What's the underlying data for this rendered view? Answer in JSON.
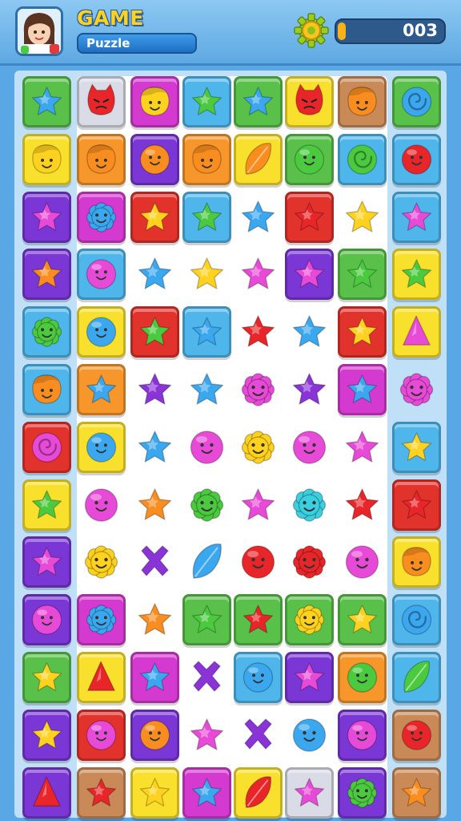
{
  "header": {
    "title": "GAME",
    "subtitle": "Puzzle",
    "score": "003",
    "score_progress": 0.08,
    "settings_icon": "gear-coin-icon",
    "avatar_icon": "player-avatar-icon"
  },
  "colors": {
    "background": "#5aa7e6",
    "title": "#ffd21f",
    "score_fill": "#f7b21a"
  },
  "tile_colors": {
    "b": "#4fb6ec",
    "y": "#f9e02c",
    "p": "#7b36d6",
    "r": "#e2322c",
    "g": "#59c04a",
    "m": "#d53ad0",
    "o": "#f7962a",
    "br": "#c98a58",
    "gr": "#d9dbe6",
    "w": "none"
  },
  "piece_colors": {
    "b": "#3aa7ef",
    "y": "#ffd21f",
    "p": "#8a34d8",
    "r": "#e8262a",
    "g": "#4bc93f",
    "m": "#e84ad8",
    "o": "#f98d1f",
    "t": "#3ad0e0"
  },
  "board": {
    "rows": [
      [
        {
          "t": "g",
          "s": "star",
          "c": "b"
        },
        {
          "t": "gr",
          "s": "devil",
          "c": "r"
        },
        {
          "t": "m",
          "s": "face",
          "c": "y"
        },
        {
          "t": "b",
          "s": "star",
          "c": "g"
        },
        {
          "t": "g",
          "s": "star",
          "c": "b"
        },
        {
          "t": "y",
          "s": "devil",
          "c": "r"
        },
        {
          "t": "br",
          "s": "face",
          "c": "o"
        },
        {
          "t": "g",
          "s": "swirl",
          "c": "b"
        }
      ],
      [
        {
          "t": "y",
          "s": "face",
          "c": "y"
        },
        {
          "t": "o",
          "s": "face",
          "c": "o"
        },
        {
          "t": "p",
          "s": "circle",
          "c": "o"
        },
        {
          "t": "o",
          "s": "face",
          "c": "o"
        },
        {
          "t": "y",
          "s": "leaf",
          "c": "o"
        },
        {
          "t": "g",
          "s": "circle",
          "c": "g"
        },
        {
          "t": "b",
          "s": "swirl",
          "c": "g"
        },
        {
          "t": "b",
          "s": "circle",
          "c": "r"
        }
      ],
      [
        {
          "t": "p",
          "s": "star",
          "c": "m"
        },
        {
          "t": "m",
          "s": "flower",
          "c": "b"
        },
        {
          "t": "r",
          "s": "star",
          "c": "y"
        },
        {
          "t": "b",
          "s": "star",
          "c": "g"
        },
        {
          "t": "w",
          "s": "star",
          "c": "b"
        },
        {
          "t": "r",
          "s": "star",
          "c": "r"
        },
        {
          "t": "w",
          "s": "star",
          "c": "y"
        },
        {
          "t": "b",
          "s": "star",
          "c": "m"
        }
      ],
      [
        {
          "t": "p",
          "s": "star",
          "c": "o"
        },
        {
          "t": "b",
          "s": "circle",
          "c": "m"
        },
        {
          "t": "w",
          "s": "star",
          "c": "b"
        },
        {
          "t": "w",
          "s": "star",
          "c": "y"
        },
        {
          "t": "w",
          "s": "star",
          "c": "m"
        },
        {
          "t": "p",
          "s": "star",
          "c": "m"
        },
        {
          "t": "g",
          "s": "star",
          "c": "g"
        },
        {
          "t": "y",
          "s": "star",
          "c": "g"
        }
      ],
      [
        {
          "t": "b",
          "s": "flower",
          "c": "g"
        },
        {
          "t": "y",
          "s": "circle",
          "c": "b"
        },
        {
          "t": "r",
          "s": "star",
          "c": "g"
        },
        {
          "t": "b",
          "s": "star",
          "c": "b"
        },
        {
          "t": "w",
          "s": "star",
          "c": "r"
        },
        {
          "t": "w",
          "s": "star",
          "c": "b"
        },
        {
          "t": "r",
          "s": "star",
          "c": "y"
        },
        {
          "t": "y",
          "s": "tri",
          "c": "m"
        }
      ],
      [
        {
          "t": "b",
          "s": "face",
          "c": "o"
        },
        {
          "t": "o",
          "s": "star",
          "c": "b"
        },
        {
          "t": "w",
          "s": "star",
          "c": "p"
        },
        {
          "t": "w",
          "s": "star",
          "c": "b"
        },
        {
          "t": "w",
          "s": "flower",
          "c": "m"
        },
        {
          "t": "w",
          "s": "star",
          "c": "p"
        },
        {
          "t": "m",
          "s": "star",
          "c": "b"
        },
        {
          "t": "w",
          "s": "flower",
          "c": "m"
        }
      ],
      [
        {
          "t": "r",
          "s": "swirl",
          "c": "m"
        },
        {
          "t": "y",
          "s": "circle",
          "c": "b"
        },
        {
          "t": "w",
          "s": "star",
          "c": "b"
        },
        {
          "t": "w",
          "s": "circle",
          "c": "m"
        },
        {
          "t": "w",
          "s": "flower",
          "c": "y"
        },
        {
          "t": "w",
          "s": "circle",
          "c": "m"
        },
        {
          "t": "w",
          "s": "star",
          "c": "m"
        },
        {
          "t": "b",
          "s": "star",
          "c": "y"
        }
      ],
      [
        {
          "t": "y",
          "s": "star",
          "c": "g"
        },
        {
          "t": "w",
          "s": "circle",
          "c": "m"
        },
        {
          "t": "w",
          "s": "star",
          "c": "o"
        },
        {
          "t": "w",
          "s": "flower",
          "c": "g"
        },
        {
          "t": "w",
          "s": "star",
          "c": "m"
        },
        {
          "t": "w",
          "s": "flower",
          "c": "t"
        },
        {
          "t": "w",
          "s": "star",
          "c": "r"
        },
        {
          "t": "r",
          "s": "star",
          "c": "r"
        }
      ],
      [
        {
          "t": "p",
          "s": "star",
          "c": "m"
        },
        {
          "t": "w",
          "s": "flower",
          "c": "y"
        },
        {
          "t": "w",
          "s": "x",
          "c": "p"
        },
        {
          "t": "w",
          "s": "leaf",
          "c": "b"
        },
        {
          "t": "w",
          "s": "circle",
          "c": "r"
        },
        {
          "t": "w",
          "s": "flower",
          "c": "r"
        },
        {
          "t": "w",
          "s": "circle",
          "c": "m"
        },
        {
          "t": "y",
          "s": "face",
          "c": "o"
        }
      ],
      [
        {
          "t": "p",
          "s": "circle",
          "c": "m"
        },
        {
          "t": "m",
          "s": "flower",
          "c": "b"
        },
        {
          "t": "w",
          "s": "star",
          "c": "o"
        },
        {
          "t": "g",
          "s": "star",
          "c": "g"
        },
        {
          "t": "g",
          "s": "star",
          "c": "r"
        },
        {
          "t": "g",
          "s": "flower",
          "c": "y"
        },
        {
          "t": "g",
          "s": "star",
          "c": "y"
        },
        {
          "t": "b",
          "s": "swirl",
          "c": "b"
        }
      ],
      [
        {
          "t": "g",
          "s": "star",
          "c": "y"
        },
        {
          "t": "y",
          "s": "tri",
          "c": "r"
        },
        {
          "t": "m",
          "s": "star",
          "c": "b"
        },
        {
          "t": "w",
          "s": "x",
          "c": "p"
        },
        {
          "t": "b",
          "s": "circle",
          "c": "b"
        },
        {
          "t": "p",
          "s": "star",
          "c": "m"
        },
        {
          "t": "o",
          "s": "circle",
          "c": "g"
        },
        {
          "t": "b",
          "s": "leaf",
          "c": "g"
        }
      ],
      [
        {
          "t": "p",
          "s": "star",
          "c": "y"
        },
        {
          "t": "r",
          "s": "circle",
          "c": "m"
        },
        {
          "t": "p",
          "s": "circle",
          "c": "o"
        },
        {
          "t": "w",
          "s": "star",
          "c": "m"
        },
        {
          "t": "w",
          "s": "x",
          "c": "p"
        },
        {
          "t": "w",
          "s": "circle",
          "c": "b"
        },
        {
          "t": "p",
          "s": "circle",
          "c": "m"
        },
        {
          "t": "br",
          "s": "circle",
          "c": "r"
        }
      ],
      [
        {
          "t": "p",
          "s": "tri",
          "c": "r"
        },
        {
          "t": "br",
          "s": "star",
          "c": "r"
        },
        {
          "t": "y",
          "s": "star",
          "c": "y"
        },
        {
          "t": "m",
          "s": "star",
          "c": "b"
        },
        {
          "t": "y",
          "s": "leaf",
          "c": "r"
        },
        {
          "t": "gr",
          "s": "star",
          "c": "m"
        },
        {
          "t": "p",
          "s": "flower",
          "c": "g"
        },
        {
          "t": "br",
          "s": "star",
          "c": "o"
        }
      ]
    ]
  }
}
